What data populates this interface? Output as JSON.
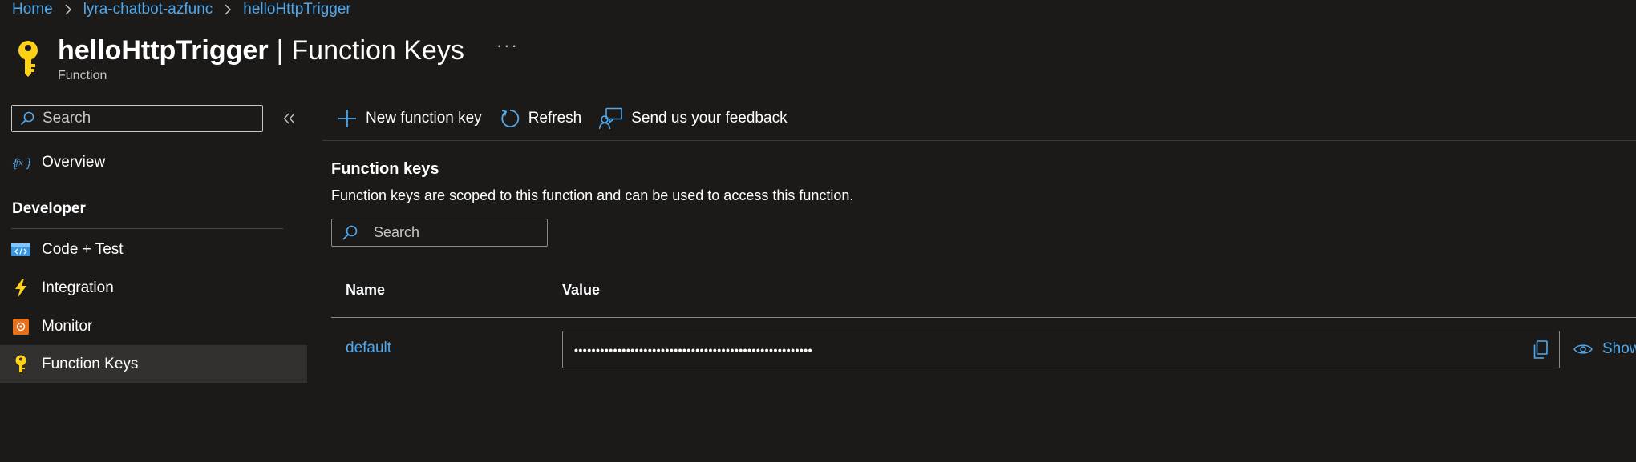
{
  "breadcrumb": {
    "items": [
      "Home",
      "lyra-chatbot-azfunc",
      "helloHttpTrigger"
    ]
  },
  "header": {
    "title": "helloHttpTrigger",
    "separator": "|",
    "subtitle": "Function Keys",
    "more": "···",
    "resource_type": "Function",
    "icon": "key-icon"
  },
  "sidebar": {
    "search_placeholder": "Search",
    "collapse_icon": "double-chevron-left-icon",
    "overview_label": "Overview",
    "group_label": "Developer",
    "items": [
      {
        "label": "Code + Test",
        "icon": "code-icon"
      },
      {
        "label": "Integration",
        "icon": "lightning-icon"
      },
      {
        "label": "Monitor",
        "icon": "monitor-icon"
      },
      {
        "label": "Function Keys",
        "icon": "key-icon",
        "active": true
      }
    ]
  },
  "toolbar": {
    "new_key_label": "New function key",
    "refresh_label": "Refresh",
    "feedback_label": "Send us your feedback"
  },
  "main": {
    "section_title": "Function keys",
    "section_desc": "Function keys are scoped to this function and can be used to access this function.",
    "search_placeholder": "Search",
    "table": {
      "columns": [
        "Name",
        "Value"
      ],
      "rows": [
        {
          "name": "default",
          "value": "•••••••••••••••••••••••••••••••••••••••••••••••••••••••",
          "show_label": "Show"
        }
      ]
    }
  },
  "colors": {
    "background": "#1b1a19",
    "link": "#4fa9ee",
    "active_nav": "#323130",
    "key_yellow": "#fcd116"
  }
}
